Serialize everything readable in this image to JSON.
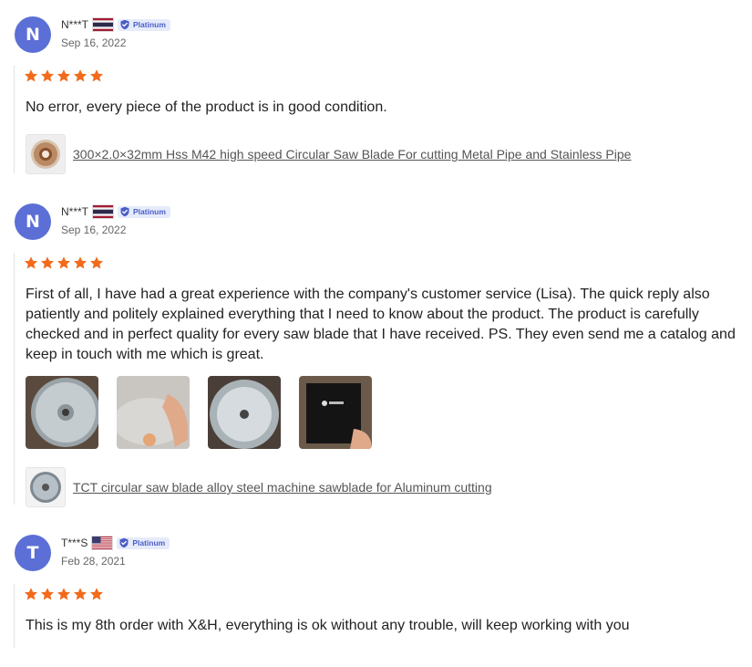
{
  "reviews": [
    {
      "avatar_letter": "N",
      "username": "N***T",
      "country_flag": "flag-thailand-icon",
      "badge": "Platinum",
      "date": "Sep 16, 2022",
      "rating": 5,
      "text": "No error, every piece of the product is in good condition.",
      "product_link": "300×2.0×32mm Hss M42 high speed Circular Saw Blade For cutting Metal Pipe and Stainless Pipe"
    },
    {
      "avatar_letter": "N",
      "username": "N***T",
      "country_flag": "flag-thailand-icon",
      "badge": "Platinum",
      "date": "Sep 16, 2022",
      "rating": 5,
      "text": "First of all, I have had a great experience with the company's customer service (Lisa). The quick reply also patiently and politely explained everything that I need to know about the product. The product is carefully checked and in perfect quality for every saw blade that I have received. PS. They even send me a catalog and keep in touch with me which is great.",
      "photos": [
        "saw-blade-photo",
        "hand-holding-blade-photo",
        "blade-closeup-photo",
        "black-catalog-photo"
      ],
      "product_link": "TCT circular saw blade alloy steel machine sawblade for Aluminum cutting"
    },
    {
      "avatar_letter": "T",
      "username": "T***S",
      "country_flag": "flag-usa-icon",
      "badge": "Platinum",
      "date": "Feb 28, 2021",
      "rating": 5,
      "text": "This is my 8th order with X&H, everything is ok without any trouble, will keep working with you"
    }
  ],
  "colors": {
    "avatar": "#5b6fd6",
    "star": "#f26a1b",
    "badge_bg": "#e6ebfb",
    "badge_text": "#4b5ec7"
  }
}
